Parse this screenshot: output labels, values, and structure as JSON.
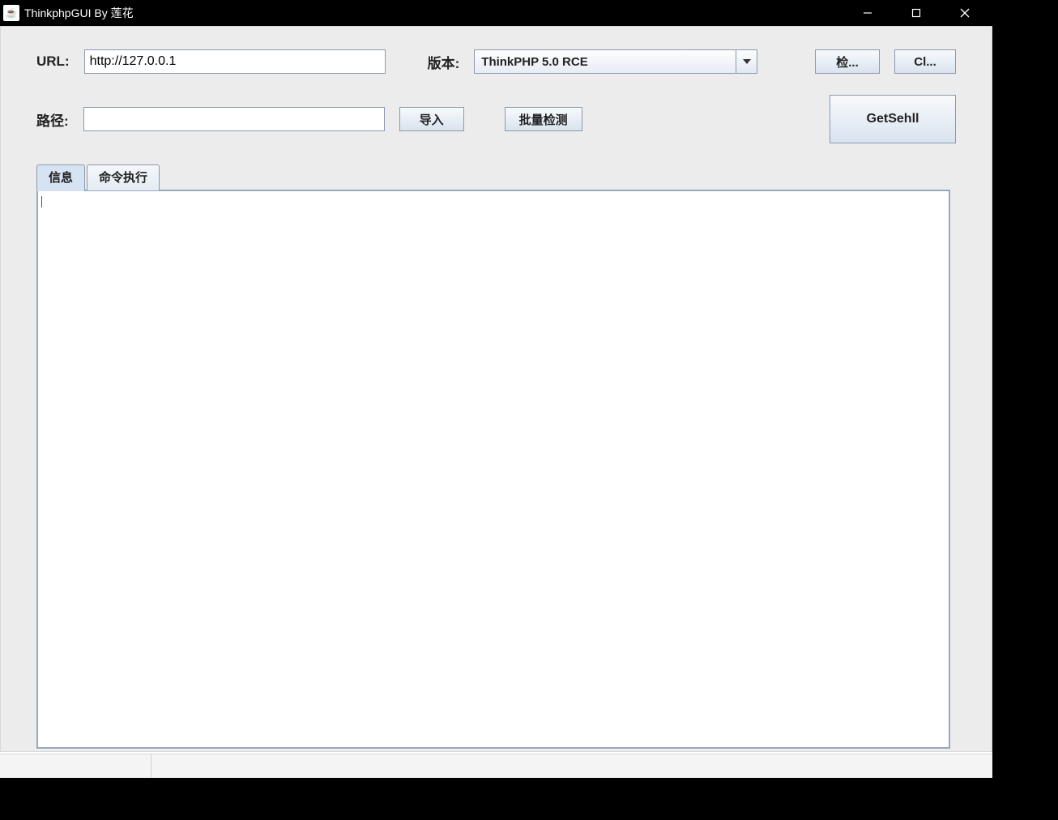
{
  "titlebar": {
    "icon_glyph": "☕",
    "title": "ThinkphpGUI By 莲花"
  },
  "form": {
    "url_label": "URL:",
    "url_value": "http://127.0.0.1",
    "version_label": "版本:",
    "version_selected": "ThinkPHP 5.0 RCE",
    "path_label": "路径:",
    "path_value": ""
  },
  "buttons": {
    "check": "检...",
    "clear": "Cl...",
    "import": "导入",
    "batch_detect": "批量检测",
    "get_shell": "GetSehll"
  },
  "tabs": [
    {
      "label": "信息",
      "active": true
    },
    {
      "label": "命令执行",
      "active": false
    }
  ]
}
